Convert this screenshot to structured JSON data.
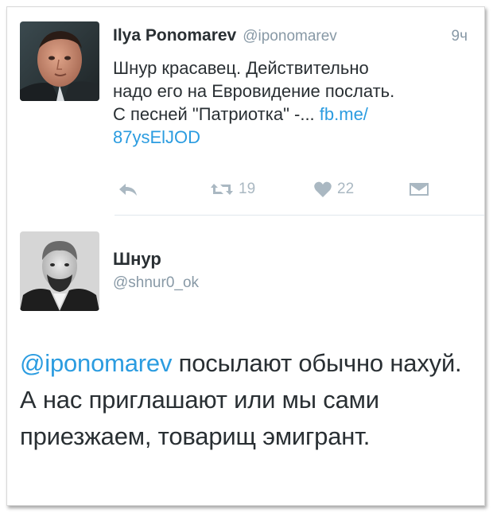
{
  "tweet1": {
    "author_name": "Ilya Ponomarev",
    "author_handle": "@iponomarev",
    "time": "9ч",
    "text_lines": [
      "Шнур красавец. Действительно",
      "надо его на Евровидение послать.",
      "С песней \"Патриотка\" -... "
    ],
    "link_part1": "fb.me/",
    "link_part2": "87ysElJOD",
    "retweet_count": "19",
    "like_count": "22",
    "icons": [
      "reply-icon",
      "retweet-icon",
      "heart-icon",
      "dm-icon"
    ]
  },
  "tweet2": {
    "author_name": "Шнур",
    "author_handle": "@shnur0_ok",
    "mention": "@iponomarev",
    "text_rest": " посылают обычно нахуй. А нас приглашают или мы сами приезжаем, товарищ эмигрант."
  },
  "colors": {
    "link": "#2b9ce0",
    "muted": "#8899a6",
    "icon": "#aab8c2",
    "text": "#292f33"
  }
}
